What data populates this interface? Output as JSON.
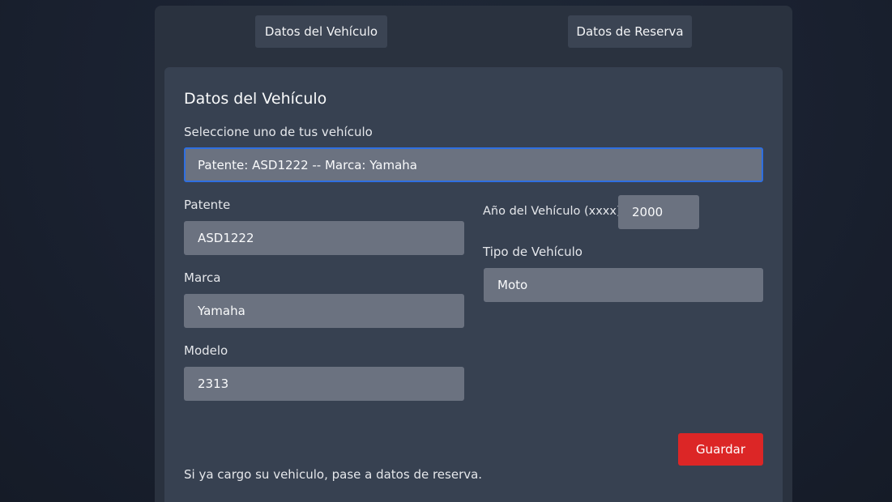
{
  "tabs": {
    "vehiculo": "Datos del Vehículo",
    "reserva": "Datos de Reserva"
  },
  "card": {
    "title": "Datos del Vehículo",
    "select_label": "Seleccione uno de tus vehículo",
    "select_value": "Patente: ASD1222 -- Marca: Yamaha",
    "patente_label": "Patente",
    "patente_value": "ASD1222",
    "marca_label": "Marca",
    "marca_value": "Yamaha",
    "modelo_label": "Modelo",
    "modelo_value": "2313",
    "anio_label": "Año del Vehículo (xxxx)",
    "anio_value": "2000",
    "tipo_label": "Tipo de Vehículo",
    "tipo_value": "Moto",
    "save_label": "Guardar",
    "footer_note": "Si ya cargo su vehiculo, pase a datos de reserva."
  },
  "colors": {
    "background": "#1a2130",
    "panel": "#2a323f",
    "card": "#374151",
    "field": "#6b7280",
    "focus_border": "#2f6fe0",
    "primary_button": "#dc2626"
  }
}
